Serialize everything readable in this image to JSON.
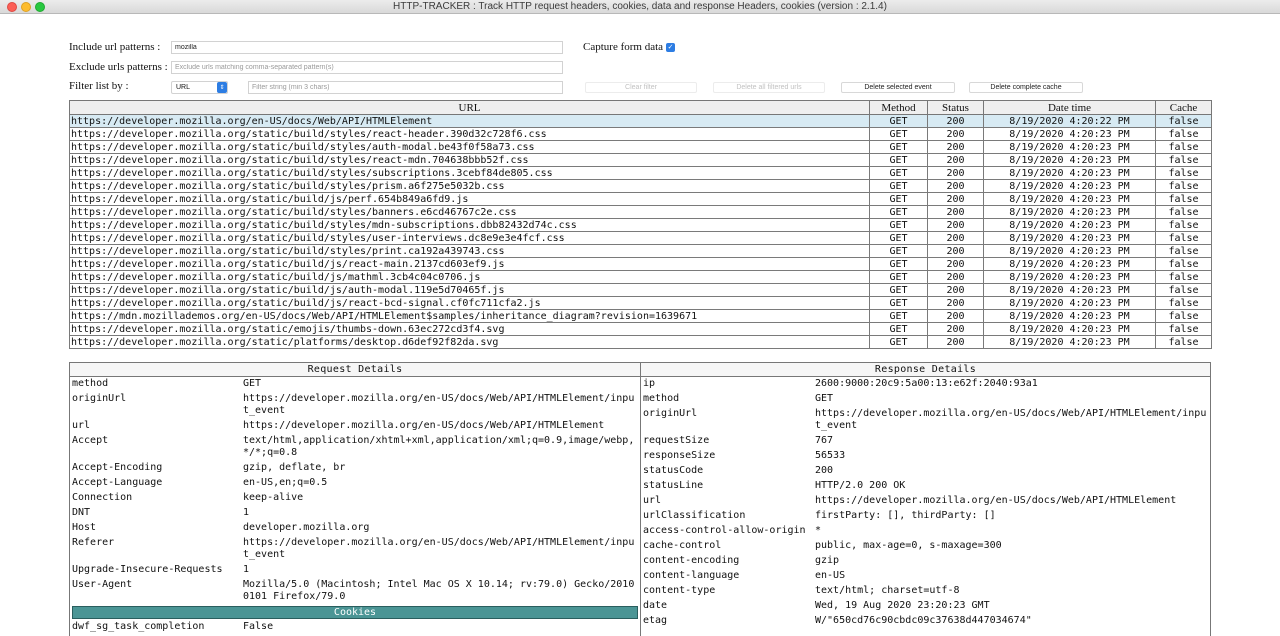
{
  "window": {
    "title": "HTTP-TRACKER : Track HTTP request headers, cookies, data and response Headers, cookies (version : 2.1.4)"
  },
  "form": {
    "include_label": "Include url patterns :",
    "include_value": "mozilla",
    "capture_label": "Capture form data",
    "capture_checked": true,
    "exclude_label": "Exclude urls patterns :",
    "exclude_placeholder": "Exclude urls matching comma-separated pattern(s)",
    "filter_label": "Filter list by :",
    "filter_select": "URL",
    "filter_placeholder": "Filter string (min 3 chars)",
    "clear_filter": "Clear filter",
    "delete_filtered": "Delete all filtered urls",
    "delete_selected": "Delete selected event",
    "delete_cache": "Delete complete cache"
  },
  "table": {
    "headers": [
      "URL",
      "Method",
      "Status",
      "Date time",
      "Cache"
    ],
    "rows": [
      [
        "https://developer.mozilla.org/en-US/docs/Web/API/HTMLElement",
        "GET",
        "200",
        "8/19/2020 4:20:22 PM",
        "false"
      ],
      [
        "https://developer.mozilla.org/static/build/styles/react-header.390d32c728f6.css",
        "GET",
        "200",
        "8/19/2020 4:20:23 PM",
        "false"
      ],
      [
        "https://developer.mozilla.org/static/build/styles/auth-modal.be43f0f58a73.css",
        "GET",
        "200",
        "8/19/2020 4:20:23 PM",
        "false"
      ],
      [
        "https://developer.mozilla.org/static/build/styles/react-mdn.704638bbb52f.css",
        "GET",
        "200",
        "8/19/2020 4:20:23 PM",
        "false"
      ],
      [
        "https://developer.mozilla.org/static/build/styles/subscriptions.3cebf84de805.css",
        "GET",
        "200",
        "8/19/2020 4:20:23 PM",
        "false"
      ],
      [
        "https://developer.mozilla.org/static/build/styles/prism.a6f275e5032b.css",
        "GET",
        "200",
        "8/19/2020 4:20:23 PM",
        "false"
      ],
      [
        "https://developer.mozilla.org/static/build/js/perf.654b849a6fd9.js",
        "GET",
        "200",
        "8/19/2020 4:20:23 PM",
        "false"
      ],
      [
        "https://developer.mozilla.org/static/build/styles/banners.e6cd46767c2e.css",
        "GET",
        "200",
        "8/19/2020 4:20:23 PM",
        "false"
      ],
      [
        "https://developer.mozilla.org/static/build/styles/mdn-subscriptions.dbb82432d74c.css",
        "GET",
        "200",
        "8/19/2020 4:20:23 PM",
        "false"
      ],
      [
        "https://developer.mozilla.org/static/build/styles/user-interviews.dc8e9e3e4fcf.css",
        "GET",
        "200",
        "8/19/2020 4:20:23 PM",
        "false"
      ],
      [
        "https://developer.mozilla.org/static/build/styles/print.ca192a439743.css",
        "GET",
        "200",
        "8/19/2020 4:20:23 PM",
        "false"
      ],
      [
        "https://developer.mozilla.org/static/build/js/react-main.2137cd603ef9.js",
        "GET",
        "200",
        "8/19/2020 4:20:23 PM",
        "false"
      ],
      [
        "https://developer.mozilla.org/static/build/js/mathml.3cb4c04c0706.js",
        "GET",
        "200",
        "8/19/2020 4:20:23 PM",
        "false"
      ],
      [
        "https://developer.mozilla.org/static/build/js/auth-modal.119e5d70465f.js",
        "GET",
        "200",
        "8/19/2020 4:20:23 PM",
        "false"
      ],
      [
        "https://developer.mozilla.org/static/build/js/react-bcd-signal.cf0fc711cfa2.js",
        "GET",
        "200",
        "8/19/2020 4:20:23 PM",
        "false"
      ],
      [
        "https://mdn.mozillademos.org/en-US/docs/Web/API/HTMLElement$samples/inheritance_diagram?revision=1639671",
        "GET",
        "200",
        "8/19/2020 4:20:23 PM",
        "false"
      ],
      [
        "https://developer.mozilla.org/static/emojis/thumbs-down.63ec272cd3f4.svg",
        "GET",
        "200",
        "8/19/2020 4:20:23 PM",
        "false"
      ],
      [
        "https://developer.mozilla.org/static/platforms/desktop.d6def92f82da.svg",
        "GET",
        "200",
        "8/19/2020 4:20:23 PM",
        "false"
      ]
    ]
  },
  "request": {
    "title": "Request Details",
    "items": [
      [
        "method",
        "GET"
      ],
      [
        "originUrl",
        "https://developer.mozilla.org/en-US/docs/Web/API/HTMLElement/input_event"
      ],
      [
        "url",
        "https://developer.mozilla.org/en-US/docs/Web/API/HTMLElement"
      ],
      [
        "Accept",
        "text/html,application/xhtml+xml,application/xml;q=0.9,image/webp,*/*;q=0.8"
      ],
      [
        "Accept-Encoding",
        "gzip, deflate, br"
      ],
      [
        "Accept-Language",
        "en-US,en;q=0.5"
      ],
      [
        "Connection",
        "keep-alive"
      ],
      [
        "DNT",
        "1"
      ],
      [
        "Host",
        "developer.mozilla.org"
      ],
      [
        "Referer",
        "https://developer.mozilla.org/en-US/docs/Web/API/HTMLElement/input_event"
      ],
      [
        "Upgrade-Insecure-Requests",
        "1"
      ],
      [
        "User-Agent",
        "Mozilla/5.0 (Macintosh; Intel Mac OS X 10.14; rv:79.0) Gecko/20100101 Firefox/79.0"
      ]
    ],
    "cookies_title": "Cookies",
    "cookies": [
      [
        "dwf_sg_task_completion",
        "False"
      ]
    ]
  },
  "response": {
    "title": "Response Details",
    "items": [
      [
        "ip",
        "2600:9000:20c9:5a00:13:e62f:2040:93a1"
      ],
      [
        "method",
        "GET"
      ],
      [
        "originUrl",
        "https://developer.mozilla.org/en-US/docs/Web/API/HTMLElement/input_event"
      ],
      [
        "requestSize",
        "767"
      ],
      [
        "responseSize",
        "56533"
      ],
      [
        "statusCode",
        "200"
      ],
      [
        "statusLine",
        "HTTP/2.0 200 OK"
      ],
      [
        "url",
        "https://developer.mozilla.org/en-US/docs/Web/API/HTMLElement"
      ],
      [
        "urlClassification",
        "firstParty: [], thirdParty: []"
      ],
      [
        "access-control-allow-origin",
        "*"
      ],
      [
        "cache-control",
        "public, max-age=0, s-maxage=300"
      ],
      [
        "content-encoding",
        "gzip"
      ],
      [
        "content-language",
        "en-US"
      ],
      [
        "content-type",
        "text/html; charset=utf-8"
      ],
      [
        "date",
        "Wed, 19 Aug 2020 23:20:23 GMT"
      ],
      [
        "etag",
        "W/\"650cd76c90cbdc09c37638d447034674\""
      ]
    ]
  }
}
